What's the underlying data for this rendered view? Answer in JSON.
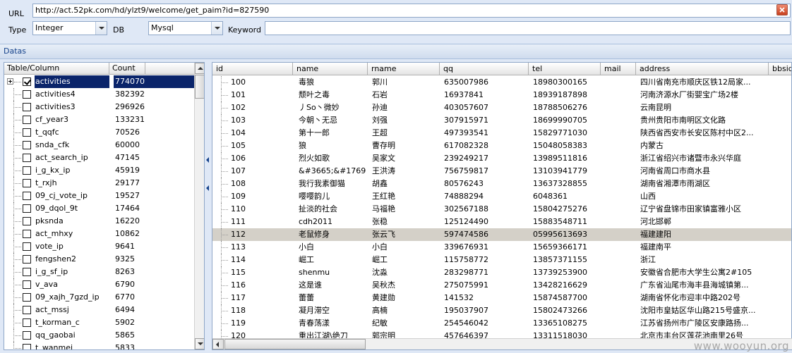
{
  "form": {
    "url_label": "URL",
    "url_value": "http://act.52pk.com/hd/ylzt9/welcome/get_paim?id=827590",
    "type_label": "Type",
    "type_value": "Integer",
    "db_label": "DB",
    "db_value": "Mysql",
    "keyword_label": "Keyword",
    "keyword_value": ""
  },
  "panel_title": "Datas",
  "left": {
    "headers": [
      "Table/Column",
      "Count"
    ],
    "rows": [
      {
        "name": "activities",
        "count": "774070",
        "checked": true,
        "selected": true
      },
      {
        "name": "activities4",
        "count": "382392"
      },
      {
        "name": "activities3",
        "count": "296926"
      },
      {
        "name": "cf_year3",
        "count": "133231"
      },
      {
        "name": "t_qqfc",
        "count": "70526"
      },
      {
        "name": "snda_cfk",
        "count": "60000"
      },
      {
        "name": "act_search_ip",
        "count": "47145"
      },
      {
        "name": "i_g_kx_ip",
        "count": "45919"
      },
      {
        "name": "t_rxjh",
        "count": "29177"
      },
      {
        "name": "09_cj_vote_ip",
        "count": "19527"
      },
      {
        "name": "09_dqol_9t",
        "count": "17464"
      },
      {
        "name": "pksnda",
        "count": "16220"
      },
      {
        "name": "act_mhxy",
        "count": "10862"
      },
      {
        "name": "vote_ip",
        "count": "9641"
      },
      {
        "name": "fengshen2",
        "count": "9325"
      },
      {
        "name": "i_g_sf_ip",
        "count": "8263"
      },
      {
        "name": "v_ava",
        "count": "6790"
      },
      {
        "name": "09_xajh_7gzd_ip",
        "count": "6770"
      },
      {
        "name": "act_mssj",
        "count": "6494"
      },
      {
        "name": "t_korman_c",
        "count": "5902"
      },
      {
        "name": "qq_gaobai",
        "count": "5865"
      },
      {
        "name": "t_wanmei",
        "count": "5833"
      }
    ]
  },
  "right": {
    "headers": [
      "id",
      "name",
      "rname",
      "qq",
      "tel",
      "mail",
      "address",
      "bbsid"
    ],
    "rows": [
      {
        "id": "100",
        "name": "毒狼",
        "rname": "郭川",
        "qq": "635007986",
        "tel": "18980300165",
        "mail": "",
        "address": "四川省南充市顺庆区铁12局家..."
      },
      {
        "id": "101",
        "name": "颓叶之毒",
        "rname": "石岩",
        "qq": "16937841",
        "tel": "18939187898",
        "mail": "",
        "address": "河南济源水厂街婴宝广场2楼"
      },
      {
        "id": "102",
        "name": "丿So丶微妙",
        "rname": "孙迪",
        "qq": "403057607",
        "tel": "18788506276",
        "mail": "",
        "address": "云南昆明"
      },
      {
        "id": "103",
        "name": "今朝丶无忌",
        "rname": "刘强",
        "qq": "307915971",
        "tel": "18699990705",
        "mail": "",
        "address": "贵州贵阳市南明区文化路"
      },
      {
        "id": "104",
        "name": "第十一郎",
        "rname": "王超",
        "qq": "497393541",
        "tel": "15829771030",
        "mail": "",
        "address": "陕西省西安市长安区陈村中区2..."
      },
      {
        "id": "105",
        "name": "狼",
        "rname": "曹存明",
        "qq": "617082328",
        "tel": "15048058383",
        "mail": "",
        "address": "内蒙古"
      },
      {
        "id": "106",
        "name": "烈火如歌",
        "rname": "吴家文",
        "qq": "239249217",
        "tel": "13989511816",
        "mail": "",
        "address": "浙江省绍兴市诸暨市永兴华庭"
      },
      {
        "id": "107",
        "name": "&#3665;&#1769...",
        "rname": "王洪涛",
        "qq": "756759817",
        "tel": "13103941779",
        "mail": "",
        "address": "河南省周口市商水县"
      },
      {
        "id": "108",
        "name": "我行我素御猫",
        "rname": "胡鑫",
        "qq": "80576243",
        "tel": "13637328855",
        "mail": "",
        "address": "湖南省湘潭市雨湖区"
      },
      {
        "id": "109",
        "name": "嘤嘤韵儿",
        "rname": "王红艳",
        "qq": "74888294",
        "tel": "6048361",
        "mail": "",
        "address": "山西"
      },
      {
        "id": "110",
        "name": "扯淡的社会",
        "rname": "马福艳",
        "qq": "302567188",
        "tel": "15804275276",
        "mail": "",
        "address": "辽宁省盘锦市田家镇富雅小区"
      },
      {
        "id": "111",
        "name": "cdh2011",
        "rname": "张稳",
        "qq": "125124490",
        "tel": "15883548711",
        "mail": "",
        "address": "河北邯郸"
      },
      {
        "id": "112",
        "name": "老鼠修身",
        "rname": "张云飞",
        "qq": "597474586",
        "tel": "05995613693",
        "mail": "",
        "address": "福建建阳",
        "selected": true
      },
      {
        "id": "113",
        "name": "小白",
        "rname": "小白",
        "qq": "339676931",
        "tel": "15659366171",
        "mail": "",
        "address": "福建南平"
      },
      {
        "id": "114",
        "name": "崛工",
        "rname": "崛工",
        "qq": "115758772",
        "tel": "13857371155",
        "mail": "",
        "address": "浙江"
      },
      {
        "id": "115",
        "name": "shenmu",
        "rname": "沈淼",
        "qq": "283298771",
        "tel": "13739253900",
        "mail": "",
        "address": "安徽省合肥市大学生公寓2#105"
      },
      {
        "id": "116",
        "name": "这是谁",
        "rname": "吴秋杰",
        "qq": "275075991",
        "tel": "13428216629",
        "mail": "",
        "address": "广东省汕尾市海丰县海城镇第..."
      },
      {
        "id": "117",
        "name": "蕾蕾",
        "rname": "黄建勋",
        "qq": "141532",
        "tel": "15874587700",
        "mail": "",
        "address": "湖南省怀化市迎丰中路202号"
      },
      {
        "id": "118",
        "name": "凝月滞空",
        "rname": "高楠",
        "qq": "195037907",
        "tel": "15802473266",
        "mail": "",
        "address": "沈阳市皇姑区华山路215号盛京..."
      },
      {
        "id": "119",
        "name": "青春荡漾",
        "rname": "纪敏",
        "qq": "254546042",
        "tel": "13365108275",
        "mail": "",
        "address": "江苏省扬州市广陵区安康路扬..."
      },
      {
        "id": "120",
        "name": "重出江湖\\绝刀",
        "rname": "郭宗明",
        "qq": "457646397",
        "tel": "13311518030",
        "mail": "",
        "address": "北京市丰台区莲花池南里26号"
      }
    ]
  },
  "watermark": "www.wooyun.org",
  "colors": {
    "selection": "#0a246a",
    "row_highlight": "#d4d0c8",
    "panel_bg": "#dfe8f6",
    "title_text": "#15428b"
  }
}
